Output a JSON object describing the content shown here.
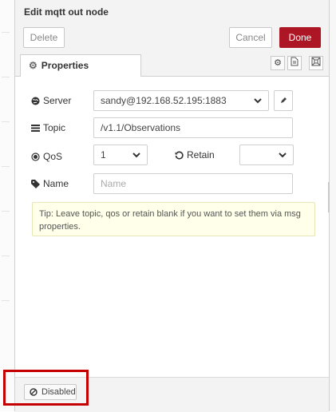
{
  "header": {
    "title": "Edit mqtt out node",
    "delete_label": "Delete",
    "cancel_label": "Cancel",
    "done_label": "Done"
  },
  "tabs": {
    "properties_label": "Properties"
  },
  "form": {
    "server": {
      "label": "Server",
      "value": "sandy@192.168.52.195:1883"
    },
    "topic": {
      "label": "Topic",
      "value": "/v1.1/Observations"
    },
    "qos": {
      "label": "QoS",
      "value": "1"
    },
    "retain": {
      "label": "Retain",
      "value": ""
    },
    "name": {
      "label": "Name",
      "placeholder": "Name"
    }
  },
  "tip": "Tip: Leave topic, qos or retain blank if you want to set them via msg properties.",
  "footer": {
    "disabled_label": "Disabled"
  },
  "colors": {
    "done_button": "#ad1625",
    "highlight_box": "#c40000",
    "tip_background": "#ffffea"
  }
}
